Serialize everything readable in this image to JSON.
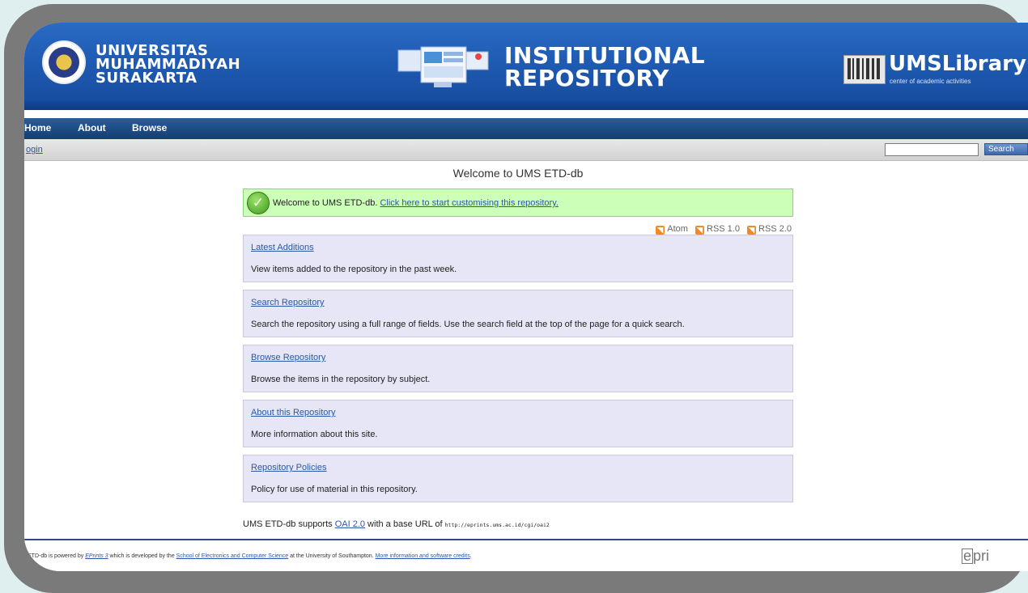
{
  "header": {
    "university_lines": [
      "UNIVERSITAS",
      "MUHAMMADIYAH",
      "SURAKARTA"
    ],
    "repository_title_lines": [
      "INSTITUTIONAL",
      "REPOSITORY"
    ],
    "library_name": "UMSLibrary",
    "library_tagline": "center of academic activities"
  },
  "nav": {
    "items": [
      {
        "label": "Home"
      },
      {
        "label": "About"
      },
      {
        "label": "Browse"
      }
    ]
  },
  "subbar": {
    "login_label": "ogin",
    "search_value": "",
    "search_button_label": "Search"
  },
  "main": {
    "title": "Welcome to UMS ETD-db",
    "message": {
      "text": "Welcome to UMS ETD-db. ",
      "link": "Click here to start customising this repository."
    },
    "feeds": [
      {
        "label": "Atom",
        "icon": "rss-icon"
      },
      {
        "label": "RSS 1.0",
        "icon": "rss-icon"
      },
      {
        "label": "RSS 2.0",
        "icon": "rss-icon"
      }
    ],
    "cards": [
      {
        "title": "Latest Additions",
        "desc": "View items added to the repository in the past week."
      },
      {
        "title": "Search Repository",
        "desc": "Search the repository using a full range of fields. Use the search field at the top of the page for a quick search."
      },
      {
        "title": "Browse Repository",
        "desc": "Browse the items in the repository by subject."
      },
      {
        "title": "About this Repository",
        "desc": "More information about this site."
      },
      {
        "title": "Repository Policies",
        "desc": "Policy for use of material in this repository."
      }
    ],
    "oai": {
      "prefix": "UMS ETD-db supports ",
      "link": "OAI 2.0",
      "middle": " with a base URL of ",
      "url": "http://eprints.ums.ac.id/cgi/oai2"
    }
  },
  "footer": {
    "text1": "ETD-db is powered by ",
    "link1": "EPrints 3",
    "text2": " which is developed by the ",
    "link2": "School of Electronics and Computer Science",
    "text3": " at the University of Southampton. ",
    "link3": "More information and software credits",
    "text4": ".",
    "logo_e": "e",
    "logo_rest": "pri"
  }
}
